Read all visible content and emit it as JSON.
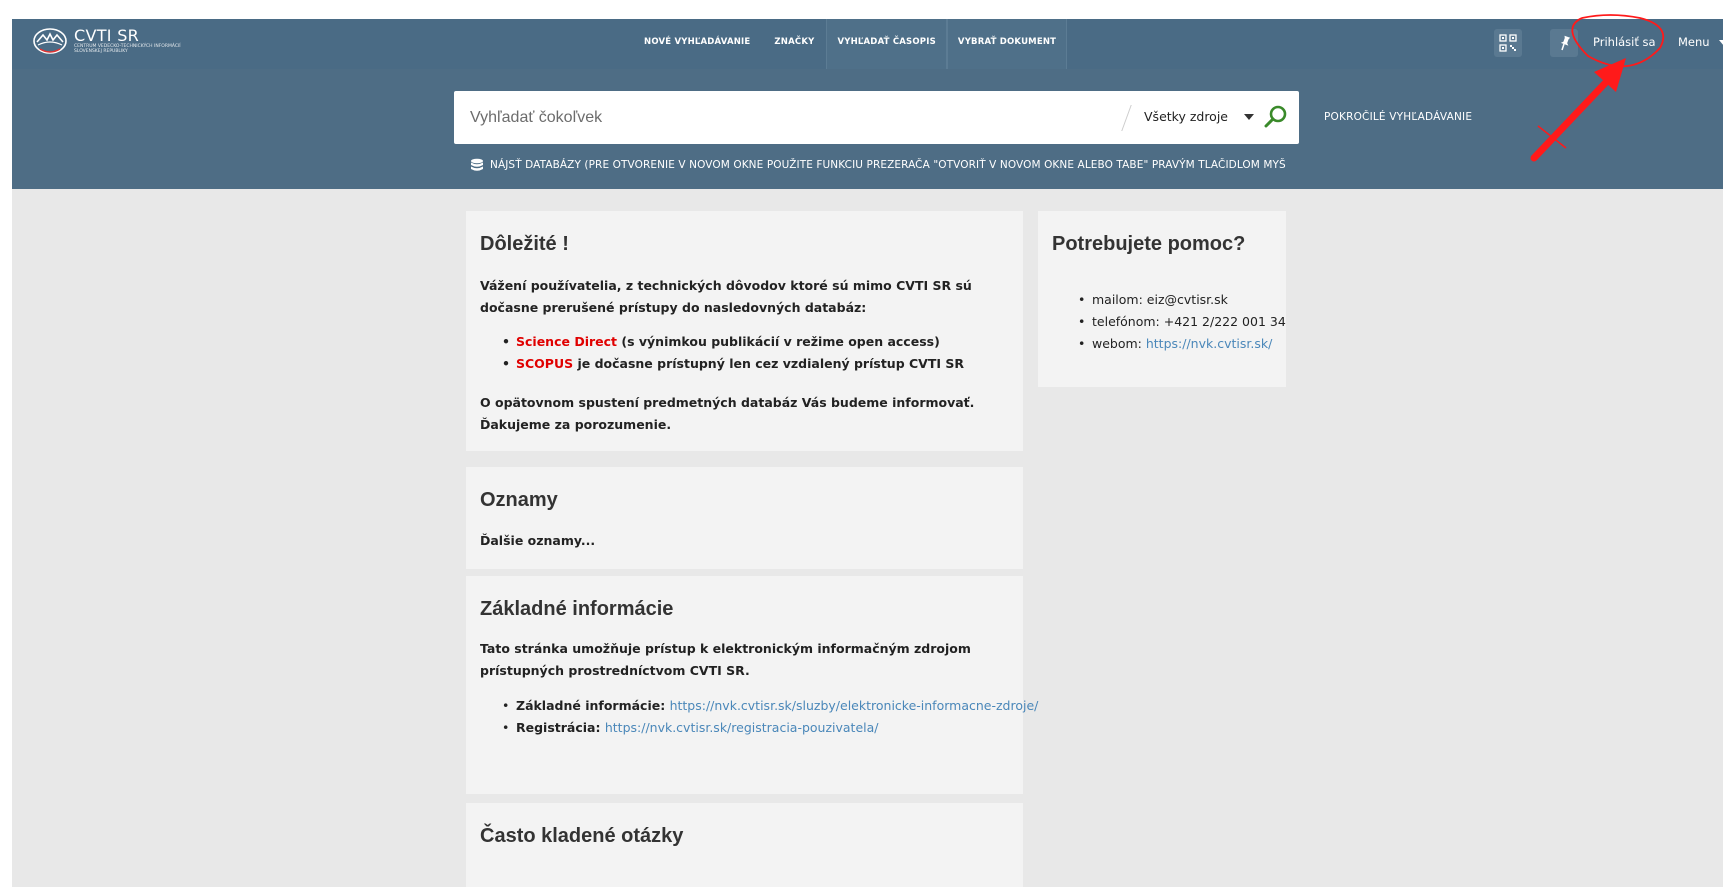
{
  "header": {
    "brand_name": "CVTI SR",
    "brand_subtitle": "Centrum vedecko-technických informácií Slovenskej republiky",
    "nav": [
      "NOVÉ VYHĽADÁVANIE",
      "ZNAČKY",
      "VYHĽADAŤ ČASOPIS",
      "VYBRAŤ DOKUMENT"
    ],
    "login_label": "Prihlásiť sa",
    "menu_label": "Menu"
  },
  "search": {
    "placeholder": "Vyhľadať čokoľvek",
    "source_label": "Všetky zdroje",
    "advanced_label": "POKROČILÉ VYHĽADÁVANIE",
    "databases_note": "NÁJSŤ DATABÁZY (PRE OTVORENIE V NOVOM OKNE POUŽITE FUNKCIU PREZERAČA \"OTVORIŤ V NOVOM OKNE ALEBO TABE\" PRAVÝM TLAČIDLOM MYŠ"
  },
  "important": {
    "title": "Dôležité !",
    "intro": "Vážení používatelia, z technických dôvodov ktoré sú mimo CVTI SR sú dočasne prerušené prístupy do nasledovných databáz:",
    "items": [
      {
        "name": "Science Direct",
        "rest": " (s výnimkou publikácií v režime open access)"
      },
      {
        "name": "SCOPUS",
        "rest": " je dočasne prístupný len cez vzdialený prístup CVTI SR"
      }
    ],
    "outro": "O opätovnom spustení predmetných databáz Vás budeme informovať. Ďakujeme za porozumenie."
  },
  "help": {
    "title": "Potrebujete pomoc?",
    "items": [
      {
        "label": "mailom: ",
        "value": "eiz@cvtisr.sk"
      },
      {
        "label": "telefónom: ",
        "value": "+421 2/222 001 34"
      },
      {
        "label": "webom: ",
        "value": "https://nvk.cvtisr.sk/"
      }
    ]
  },
  "news": {
    "title": "Oznamy",
    "more_link": "Ďalšie oznamy..."
  },
  "basic": {
    "title": "Základné informácie",
    "intro": "Tato stránka umožňuje prístup k elektronickým informačným zdrojom prístupných prostredníctvom CVTI SR.",
    "items": [
      {
        "label": "Základné informácie: ",
        "url": "https://nvk.cvtisr.sk/sluzby/elektronicke-informacne-zdroje/"
      },
      {
        "label": "Registrácia: ",
        "url": "https://nvk.cvtisr.sk/registracia-pouzivatela/"
      }
    ]
  },
  "faq": {
    "title": "Často kladené otázky"
  },
  "colors": {
    "topbar": "#4a6b85",
    "search_band": "#4e6d85",
    "accent_red": "#e00000",
    "link": "#4a87b9",
    "annotation": "#ff1a1a"
  }
}
